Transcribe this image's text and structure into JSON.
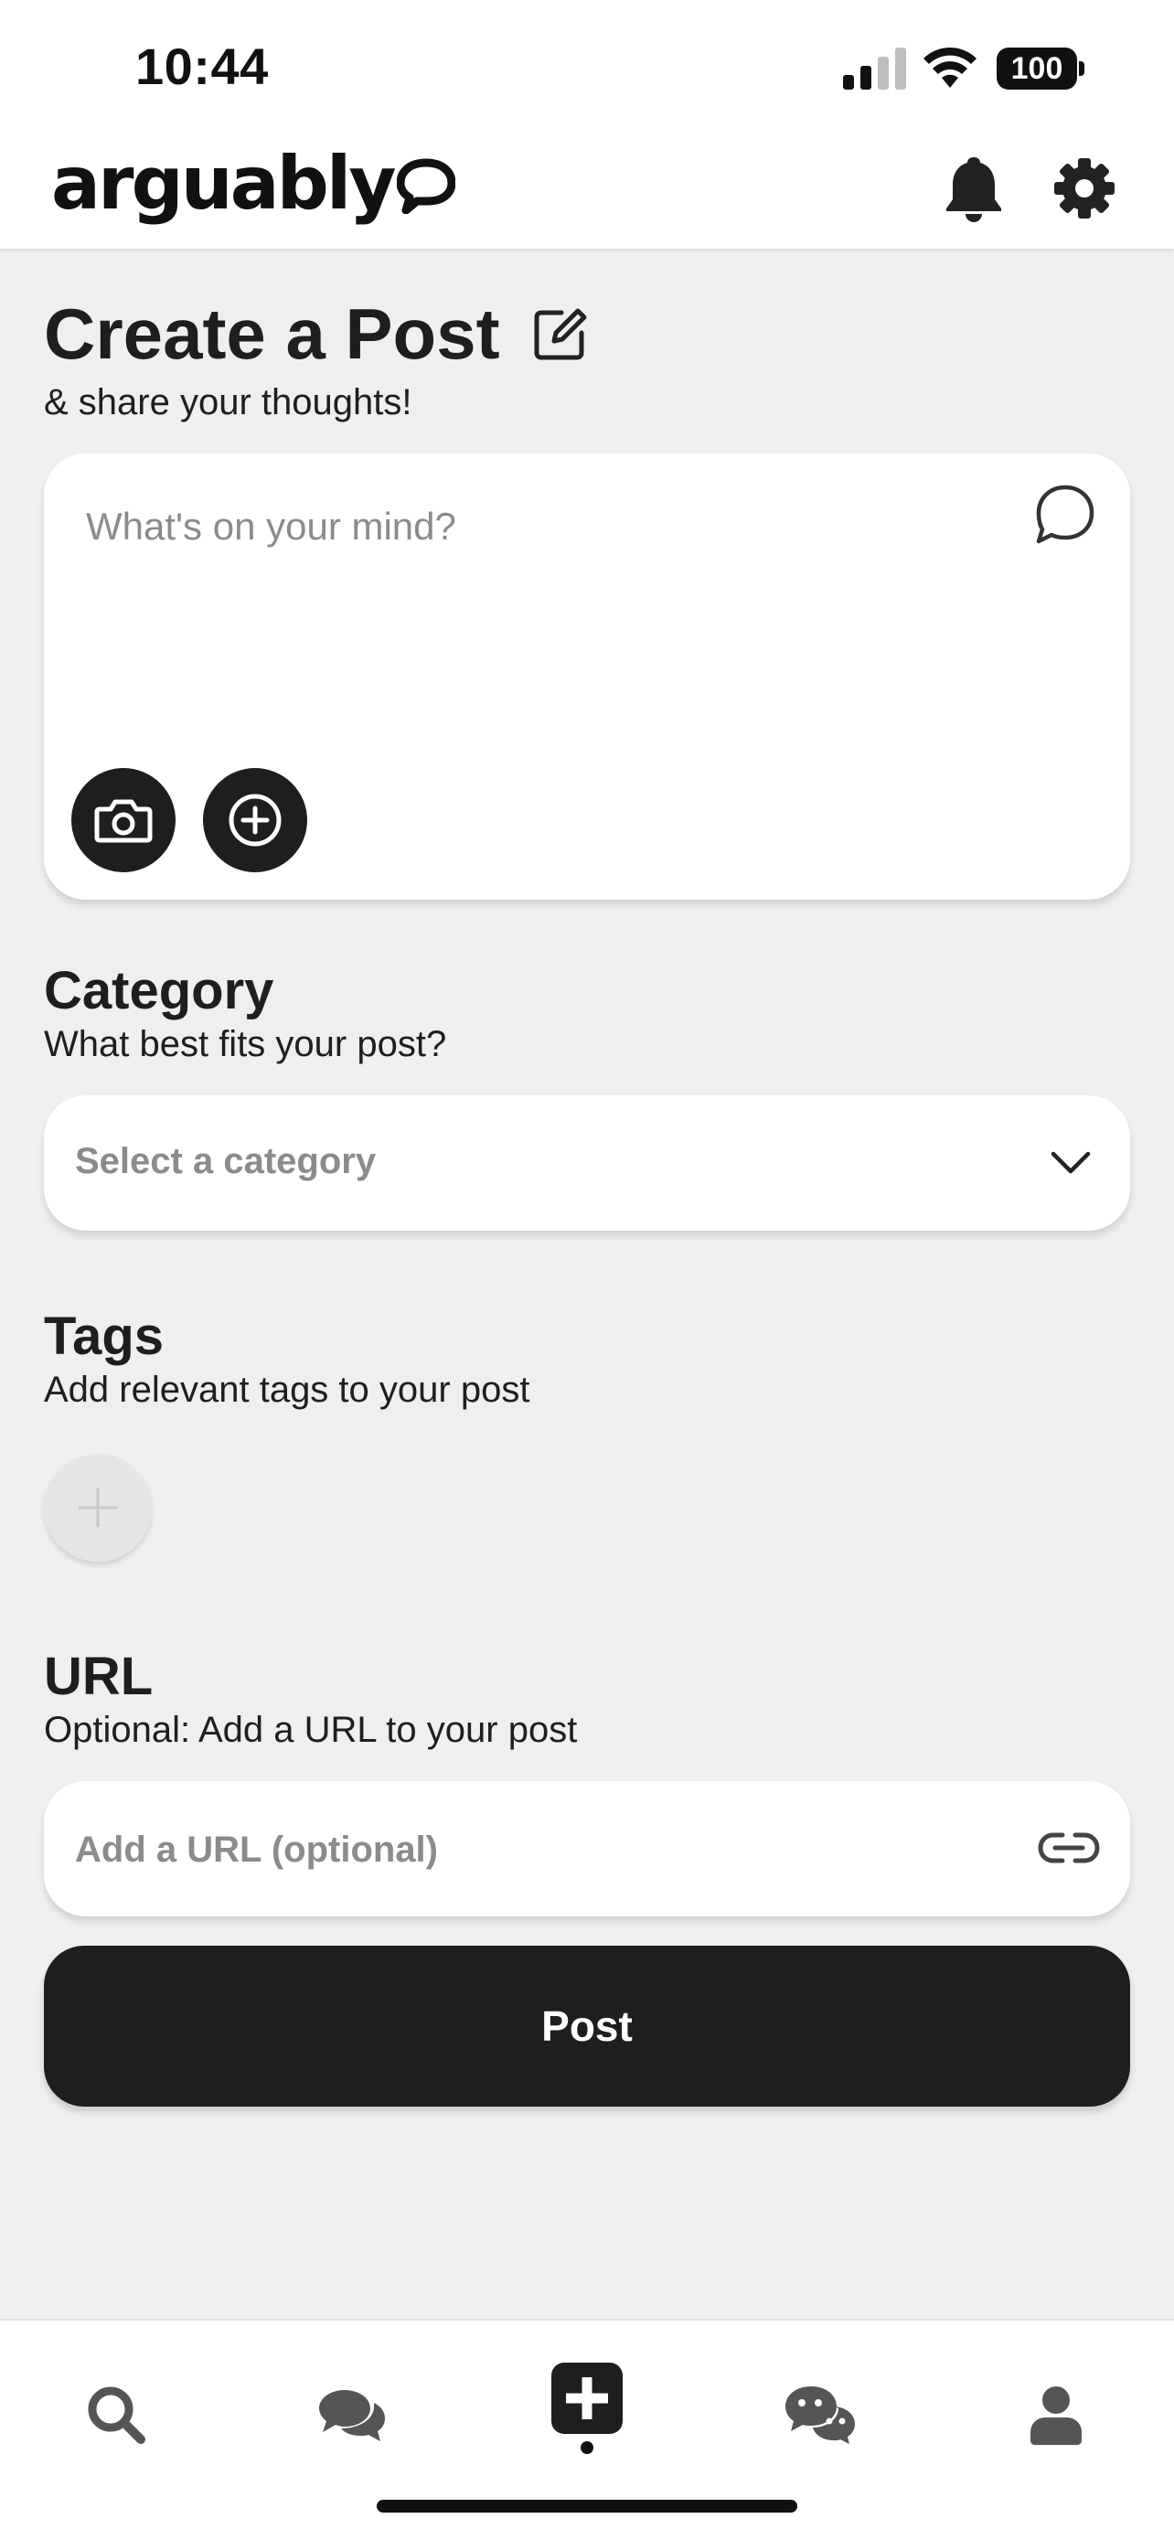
{
  "status_bar": {
    "time": "10:44",
    "battery": "100"
  },
  "header": {
    "logo_text": "arguably"
  },
  "create": {
    "title": "Create a Post",
    "subtitle": "& share your thoughts!",
    "placeholder": "What's on your mind?"
  },
  "category": {
    "title": "Category",
    "subtitle": "What best fits your post?",
    "placeholder": "Select a category"
  },
  "tags": {
    "title": "Tags",
    "subtitle": "Add relevant tags to your post"
  },
  "url": {
    "title": "URL",
    "subtitle": "Optional: Add a URL to your post",
    "placeholder": "Add a URL (optional)"
  },
  "post_button": {
    "label": "Post"
  },
  "bottom_nav": {
    "items": [
      {
        "icon": "search-icon"
      },
      {
        "icon": "chat-bubbles-icon"
      },
      {
        "icon": "create-post-icon",
        "active": true
      },
      {
        "icon": "messages-icon"
      },
      {
        "icon": "profile-icon"
      }
    ]
  },
  "colors": {
    "primary": "#1e1e1e",
    "background": "#efefef",
    "muted_text": "#8b8b8b"
  }
}
